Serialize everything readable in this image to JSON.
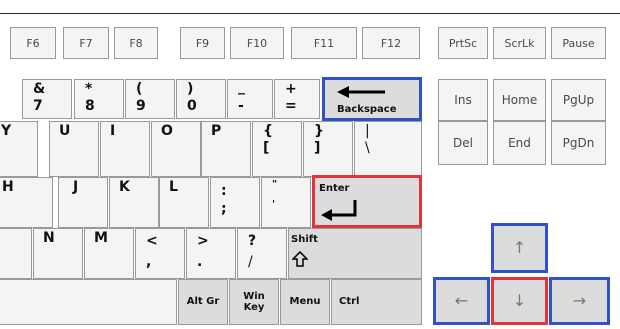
{
  "function_row": [
    "F6",
    "F7",
    "F8",
    "F9",
    "F10",
    "F11",
    "F12"
  ],
  "system_keys": [
    "PrtSc",
    "ScrLk",
    "Pause"
  ],
  "number_row": [
    {
      "top": "&",
      "bottom": "7"
    },
    {
      "top": "*",
      "bottom": "8"
    },
    {
      "top": "(",
      "bottom": "9"
    },
    {
      "top": ")",
      "bottom": "0"
    },
    {
      "top": "_",
      "bottom": "-"
    },
    {
      "top": "+",
      "bottom": "="
    }
  ],
  "backspace_label": "Backspace",
  "qwerty_row": [
    "Y",
    "U",
    "I",
    "O",
    "P"
  ],
  "bracket_keys": [
    {
      "top": "{",
      "bottom": "["
    },
    {
      "top": "}",
      "bottom": "]"
    },
    {
      "top": "|",
      "bottom": "\\"
    }
  ],
  "home_row": [
    "H",
    "J",
    "K",
    "L"
  ],
  "punct_keys_home": [
    {
      "top": ":",
      "bottom": ";"
    },
    {
      "top": "\"",
      "bottom": "'"
    }
  ],
  "enter_label": "Enter",
  "bottom_row": [
    "N",
    "M"
  ],
  "punct_keys_bottom": [
    {
      "top": "<",
      "bottom": ","
    },
    {
      "top": ">",
      "bottom": "."
    },
    {
      "top": "?",
      "bottom": "/"
    }
  ],
  "shift_label": "Shift",
  "space_row": {
    "alt_gr": "Alt Gr",
    "win_key": "Win Key",
    "menu": "Menu",
    "ctrl": "Ctrl"
  },
  "nav_cluster": {
    "row1": [
      "Ins",
      "Home",
      "PgUp"
    ],
    "row2": [
      "Del",
      "End",
      "PgDn"
    ]
  },
  "arrows": {
    "up": "↑",
    "left": "←",
    "down": "↓",
    "right": "→"
  },
  "colors": {
    "highlight_blue": "#2f52c9",
    "highlight_red": "#e0333a",
    "key_gray": "#dcdcdc",
    "key_light": "#f4f4f4"
  }
}
